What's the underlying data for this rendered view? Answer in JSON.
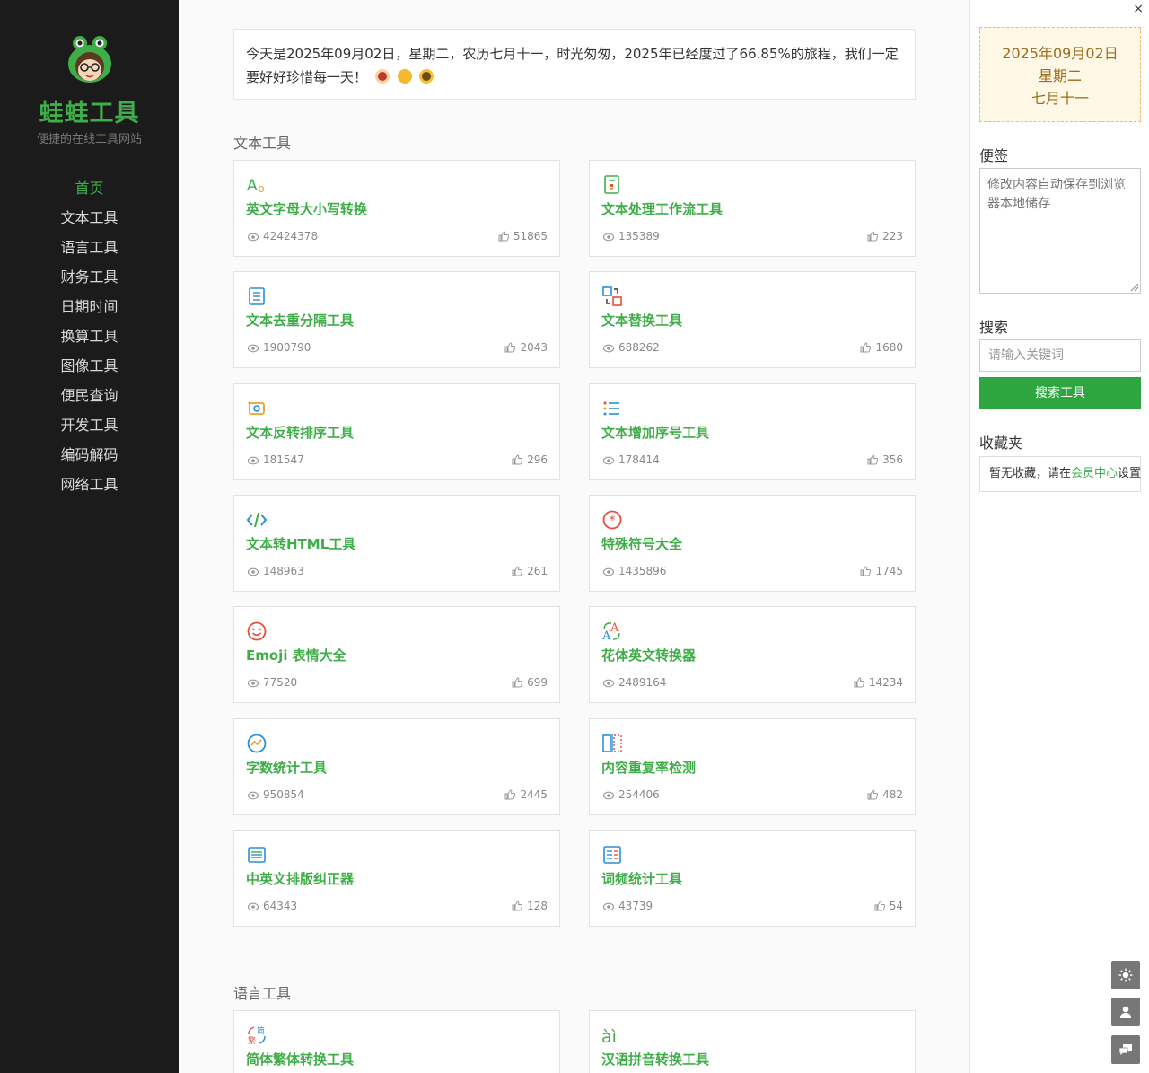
{
  "sidebar": {
    "brand": "蛙蛙工具",
    "tagline": "便捷的在线工具网站",
    "nav": [
      "首页",
      "文本工具",
      "语言工具",
      "财务工具",
      "日期时间",
      "换算工具",
      "图像工具",
      "便民查询",
      "开发工具",
      "编码解码",
      "网络工具"
    ],
    "active_index": 0
  },
  "main": {
    "banner": "今天是2025年09月02日，星期二，农历七月十一，时光匆匆，2025年已经度过了66.85%的旅程，我们一定要好好珍惜每一天！",
    "banner_emojis": [
      "clock-emoji",
      "smile-emoji",
      "sunflower-emoji"
    ],
    "sections": [
      {
        "title": "文本工具",
        "cards": [
          {
            "name": "英文字母大小写转换",
            "views": "42424378",
            "likes": "51865",
            "icon": "letter-case-icon"
          },
          {
            "name": "文本处理工作流工具",
            "views": "135389",
            "likes": "223",
            "icon": "workflow-icon"
          },
          {
            "name": "文本去重分隔工具",
            "views": "1900790",
            "likes": "2043",
            "icon": "document-icon"
          },
          {
            "name": "文本替换工具",
            "views": "688262",
            "likes": "1680",
            "icon": "replace-icon"
          },
          {
            "name": "文本反转排序工具",
            "views": "181547",
            "likes": "296",
            "icon": "reverse-icon"
          },
          {
            "name": "文本增加序号工具",
            "views": "178414",
            "likes": "356",
            "icon": "numbered-list-icon"
          },
          {
            "name": "文本转HTML工具",
            "views": "148963",
            "likes": "261",
            "icon": "code-icon"
          },
          {
            "name": "特殊符号大全",
            "views": "1435896",
            "likes": "1745",
            "icon": "asterisk-icon"
          },
          {
            "name": "Emoji 表情大全",
            "views": "77520",
            "likes": "699",
            "icon": "smiley-icon"
          },
          {
            "name": "花体英文转换器",
            "views": "2489164",
            "likes": "14234",
            "icon": "fancy-text-icon"
          },
          {
            "name": "字数统计工具",
            "views": "950854",
            "likes": "2445",
            "icon": "chart-circle-icon"
          },
          {
            "name": "内容重复率检测",
            "views": "254406",
            "likes": "482",
            "icon": "compare-icon"
          },
          {
            "name": "中英文排版纠正器",
            "views": "64343",
            "likes": "128",
            "icon": "align-text-icon"
          },
          {
            "name": "词频统计工具",
            "views": "43739",
            "likes": "54",
            "icon": "frequency-icon"
          }
        ]
      },
      {
        "title": "语言工具",
        "cards": [
          {
            "name": "简体繁体转换工具",
            "views": "",
            "likes": "",
            "icon": "simplified-traditional-icon",
            "icon_text_a": "简",
            "icon_text_b": "繁"
          },
          {
            "name": "汉语拼音转换工具",
            "views": "",
            "likes": "",
            "icon": "pinyin-icon",
            "icon_text": "àì"
          }
        ]
      }
    ]
  },
  "right": {
    "date_line1": "2025年09月02日",
    "date_line2": "星期二",
    "date_line3": "七月十一",
    "memo_label": "便签",
    "memo_placeholder": "修改内容自动保存到浏览器本地储存",
    "search_label": "搜索",
    "search_placeholder": "请输入关键词",
    "search_button": "搜索工具",
    "favorites_label": "收藏夹",
    "favorites_text_before": "暂无收藏，请在",
    "favorites_link": "会员中心",
    "favorites_text_after": "设置",
    "close": "×"
  }
}
